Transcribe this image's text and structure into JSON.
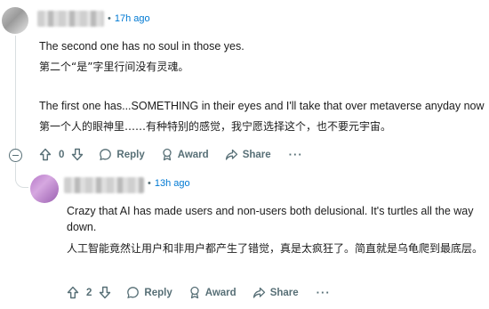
{
  "comment1": {
    "username": "",
    "separator": "•",
    "time": "17h ago",
    "paragraphs": [
      "The second one has no soul in those yes.",
      "第二个“是”字里行间没有灵魂。",
      "The first one has...SOMETHING in their eyes and I'll take that over metaverse anyday now",
      "第一个人的眼神里……有种特别的感觉，我宁愿选择这个，也不要元宇宙。"
    ],
    "vote_count": "0",
    "reply_label": "Reply",
    "award_label": "Award",
    "share_label": "Share",
    "more_label": "···"
  },
  "comment2": {
    "username": "",
    "separator": "•",
    "time": "13h ago",
    "paragraphs": [
      "Crazy that AI has made users and non-users both delusional. It's turtles all the way down.",
      "人工智能竟然让用户和非用户都产生了错觉，真是太疯狂了。简直就是乌龟爬到最底层。"
    ],
    "vote_count": "2",
    "reply_label": "Reply",
    "award_label": "Award",
    "share_label": "Share",
    "more_label": "···"
  }
}
